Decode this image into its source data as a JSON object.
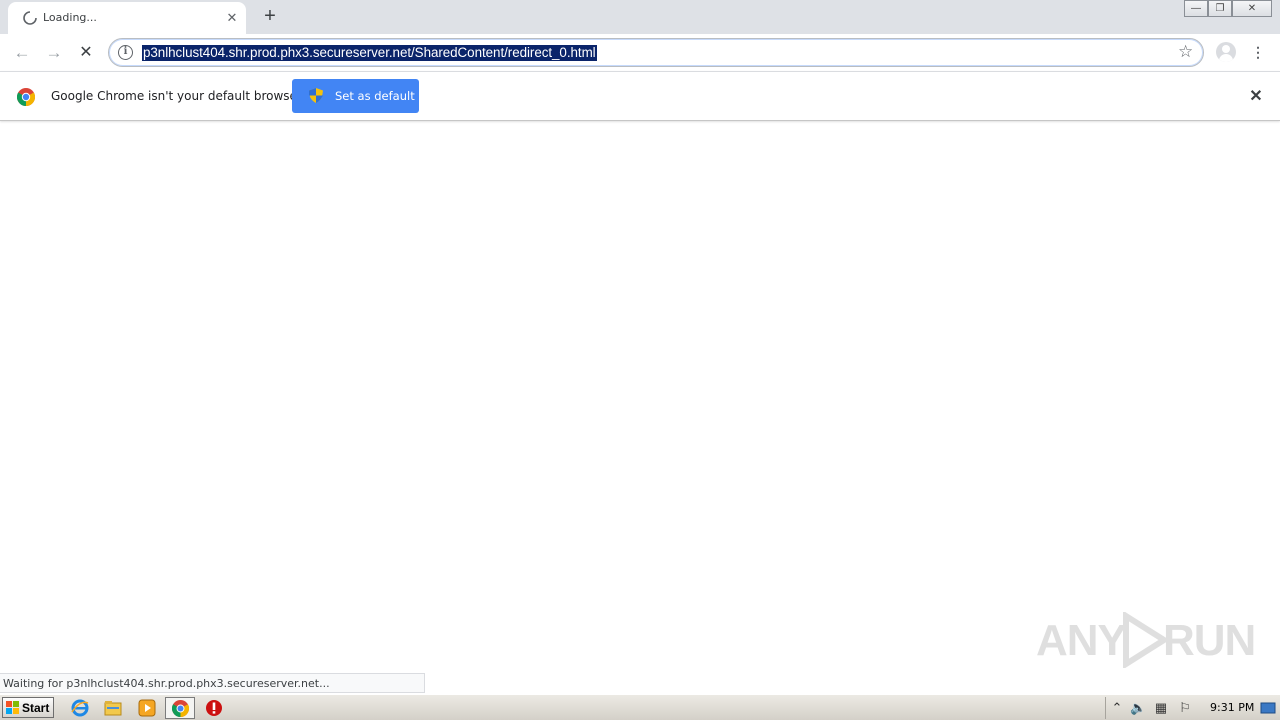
{
  "tab": {
    "title": "Loading...",
    "close": "✕",
    "new_tab": "+"
  },
  "window_controls": {
    "minimize": "—",
    "restore": "❐",
    "close": "✕"
  },
  "toolbar": {
    "url": "p3nlhclust404.shr.prod.phx3.secureserver.net/SharedContent/redirect_0.html",
    "back": "←",
    "forward": "→",
    "stop": "✕",
    "bookmark": "☆",
    "menu": "⋮",
    "info": "i"
  },
  "infobar": {
    "message": "Google Chrome isn't your default browser",
    "button": "Set as default",
    "close": "✕"
  },
  "status": {
    "text": "Waiting for p3nlhclust404.shr.prod.phx3.secureserver.net..."
  },
  "watermark": {
    "left": "ANY",
    "right": "RUN"
  },
  "taskbar": {
    "start": "Start",
    "clock": "9:31 PM"
  },
  "colors": {
    "accent": "#4285f4",
    "tabstrip": "#dee1e6",
    "url_highlight": "#0a246a"
  }
}
